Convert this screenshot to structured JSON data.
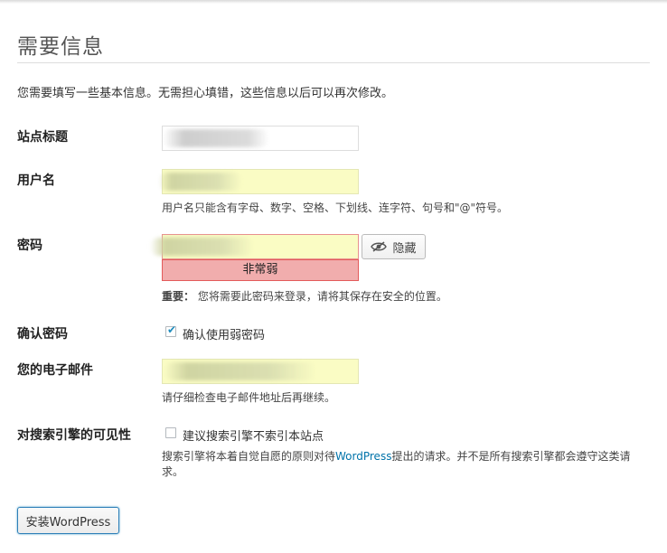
{
  "page": {
    "title": "需要信息",
    "intro": "您需要填写一些基本信息。无需担心填错，这些信息以后可以再次修改。"
  },
  "fields": {
    "site_title": {
      "label": "站点标题",
      "value": ""
    },
    "username": {
      "label": "用户名",
      "value": "",
      "hint": "用户名只能含有字母、数字、空格、下划线、连字符、句号和\"@\"符号。"
    },
    "password": {
      "label": "密码",
      "value": "",
      "hide_button": "隐藏",
      "strength": "非常弱",
      "important_label": "重要：",
      "important_text": "您将需要此密码来登录，请将其保存在安全的位置。"
    },
    "confirm_password": {
      "label": "确认密码",
      "checkbox_label": "确认使用弱密码",
      "checked": true
    },
    "email": {
      "label": "您的电子邮件",
      "value": "",
      "hint": "请仔细检查电子邮件地址后再继续。"
    },
    "search_visibility": {
      "label": "对搜索引擎的可见性",
      "checkbox_label": "建议搜索引擎不索引本站点",
      "checked": false,
      "hint_part1": "搜索引擎将本着自觉自愿的原则对待",
      "hint_link": "WordPress",
      "hint_part2": "提出的请求。并不是所有搜索引擎都会遵守这类请",
      "hint_line2": "求。"
    }
  },
  "actions": {
    "install_label": "安装WordPress"
  },
  "colors": {
    "accent": "#0073aa",
    "strength_bg": "#f1adad",
    "autofill_bg": "#fafcc4"
  },
  "icons": {
    "hide": "eye-slash-icon"
  }
}
